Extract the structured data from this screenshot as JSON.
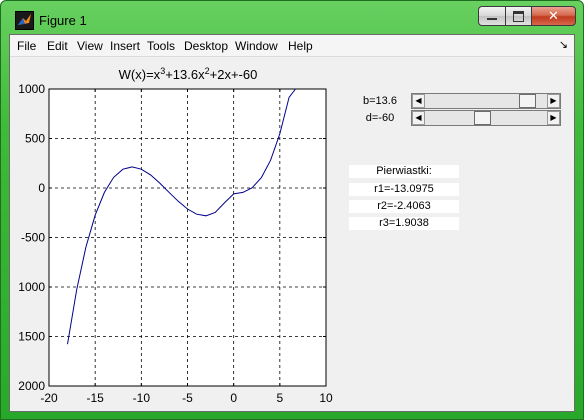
{
  "window": {
    "title": "Figure 1",
    "close_glyph": "✕"
  },
  "menu": [
    "File",
    "Edit",
    "View",
    "Insert",
    "Tools",
    "Desktop",
    "Window",
    "Help"
  ],
  "dock_glyph": "↘",
  "controls": {
    "b_label": "b=13.6",
    "d_label": "d=-60",
    "b_fraction": 0.88,
    "d_fraction": 0.46,
    "left_arrow": "◀",
    "right_arrow": "▶"
  },
  "roots": {
    "heading": "Pierwiastki:",
    "r1": "r1=-13.0975",
    "r2": "r2=-2.4063",
    "r3": "r3=1.9038"
  },
  "chart_data": {
    "type": "line",
    "title_parts": [
      "W(x)=x",
      "3",
      "+13.6x",
      "2",
      "+2x+-60"
    ],
    "xlim": [
      -20,
      10
    ],
    "ylim": [
      -2000,
      1000
    ],
    "xticks": [
      "-20",
      "-15",
      "-10",
      "-5",
      "0",
      "5",
      "10"
    ],
    "xtick_values": [
      -20,
      -15,
      -10,
      -5,
      0,
      5,
      10
    ],
    "yticks": [
      "1000",
      "500",
      "0",
      "-500",
      "-1000",
      "-1500",
      "-2000"
    ],
    "ytick_values": [
      1000,
      500,
      0,
      -500,
      -1000,
      -1500,
      -2000
    ],
    "yticks_shown": [
      "1000",
      "500",
      "0",
      "-500",
      "1000",
      "1500",
      "2000"
    ],
    "grid": true,
    "series": [
      {
        "color": "#00008b",
        "x": [
          -18,
          -17,
          -16,
          -15,
          -14,
          -13,
          -12,
          -11,
          -10,
          -9,
          -8,
          -7,
          -6,
          -5,
          -4,
          -3,
          -2,
          -1,
          0,
          1,
          2,
          3,
          4,
          5,
          6,
          6.7
        ],
        "y": [
          -1578,
          -1027,
          -597,
          -274,
          -44,
          107,
          190,
          213,
          190,
          132,
          50,
          -43,
          -134,
          -212,
          -265,
          -281,
          -247,
          -150,
          -60,
          -44,
          2,
          105,
          281,
          546,
          916,
          1000
        ]
      }
    ]
  }
}
